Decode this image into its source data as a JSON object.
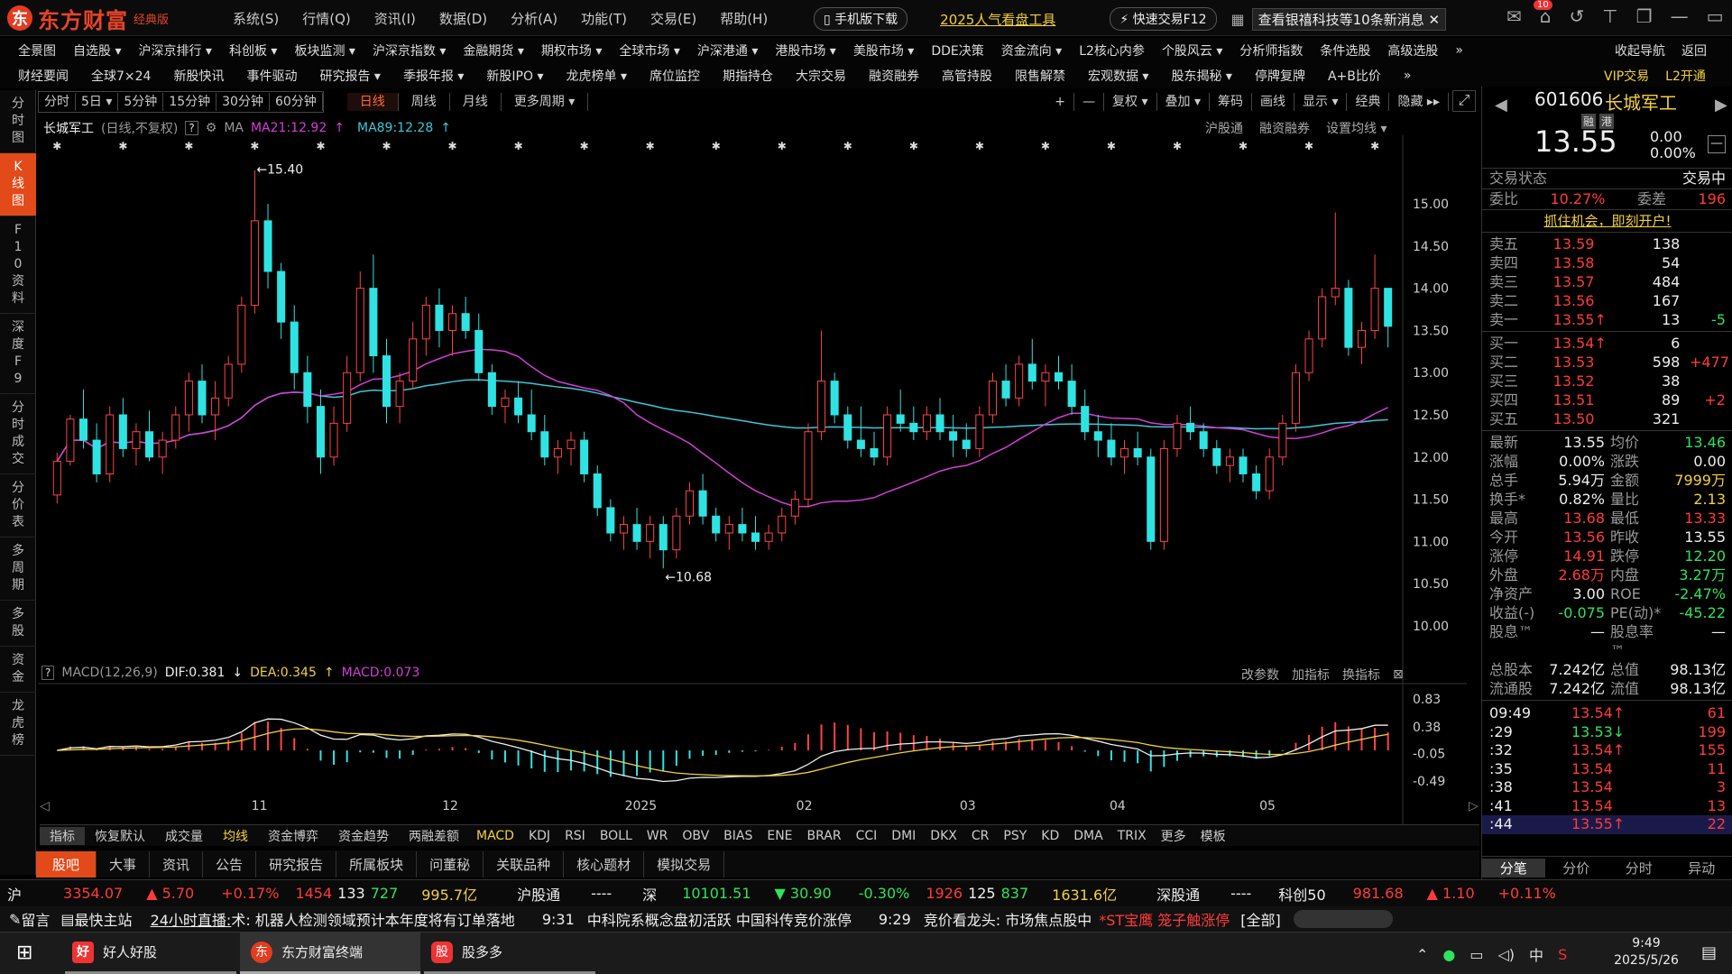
{
  "app": {
    "logo_text": "东方财富",
    "edition": "经典版",
    "logo_mark": "东"
  },
  "menu": [
    "系统(S)",
    "行情(Q)",
    "资讯(I)",
    "数据(D)",
    "分析(A)",
    "功能(T)",
    "交易(E)",
    "帮助(H)"
  ],
  "title_buttons": {
    "mobile": "手机版下载",
    "popular": "2025人气看盘工具",
    "quick_trade": "快速交易F12",
    "news": "查看银禧科技等10条新消息",
    "badge": "10"
  },
  "toolbar1": [
    "全景图",
    "自选股 ▾",
    "沪深京排行 ▾",
    "科创板 ▾",
    "板块监测 ▾",
    "沪深京指数 ▾",
    "金融期货 ▾",
    "期权市场 ▾",
    "全球市场 ▾",
    "沪深港通 ▾",
    "港股市场 ▾",
    "美股市场 ▾",
    "DDE决策",
    "资金流向 ▾",
    "L2核心内参",
    "个股风云 ▾",
    "分析师指数",
    "条件选股",
    "高级选股",
    "»"
  ],
  "toolbar1_right": [
    "收起导航",
    "返回"
  ],
  "toolbar2": [
    "财经要闻",
    "全球7×24",
    "新股快讯",
    "事件驱动",
    "研究报告 ▾",
    "季报年报 ▾",
    "新股IPO ▾",
    "龙虎榜单 ▾",
    "席位监控",
    "期指持仓",
    "大宗交易",
    "融资融券",
    "高管持股",
    "限售解禁",
    "宏观数据 ▾",
    "股东揭秘 ▾",
    "停牌复牌",
    "A+B比价",
    "»"
  ],
  "toolbar2_right": [
    "VIP交易",
    "L2开通"
  ],
  "leftbar": [
    "分时图",
    "K线图",
    "F10资料",
    "深度F9",
    "分时成交",
    "分价表",
    "多周期",
    "多股",
    "资金",
    "龙虎榜"
  ],
  "periods": [
    "分时",
    "5日 ▾",
    "5分钟",
    "15分钟",
    "30分钟",
    "60分钟"
  ],
  "periods2": [
    "日线",
    "周线",
    "月线",
    "更多周期 ▾"
  ],
  "chart_tools": [
    "+",
    "—",
    "复权 ▾",
    "叠加 ▾",
    "筹码",
    "画线",
    "显示 ▾",
    "经典",
    "隐藏 ▸▸"
  ],
  "chart_info": {
    "name": "长城军工",
    "mode": "(日线,不复权)",
    "help": "?",
    "ma_label": "MA",
    "ma21": "MA21:12.92",
    "ma89": "MA89:12.28"
  },
  "chart_links": [
    "沪股通",
    "融资融券",
    "设置均线 ▾"
  ],
  "macd_header": {
    "label": "MACD(12,26,9)",
    "dif": "DIF:0.381",
    "dea": "DEA:0.345",
    "macd": "MACD:0.073"
  },
  "macd_links": [
    "改参数",
    "加指标",
    "换指标"
  ],
  "annotations": {
    "high": "←15.40",
    "low": "←10.68"
  },
  "price_axis": [
    "15.00",
    "14.50",
    "14.00",
    "13.50",
    "13.00",
    "12.50",
    "12.00",
    "11.50",
    "11.00",
    "10.50",
    "10.00"
  ],
  "macd_axis": [
    "0.83",
    "0.38",
    "-0.05",
    "-0.49"
  ],
  "time_axis": [
    "11",
    "12",
    "2025",
    "02",
    "03",
    "04",
    "05"
  ],
  "indicators": [
    "指标",
    "恢复默认",
    "成交量",
    "均线",
    "资金博弈",
    "资金趋势",
    "两融差额",
    "MACD",
    "KDJ",
    "RSI",
    "BOLL",
    "WR",
    "OBV",
    "BIAS",
    "ENE",
    "BRAR",
    "CCI",
    "DMI",
    "DKX",
    "CR",
    "PSY",
    "KD",
    "DMA",
    "TRIX",
    "更多",
    "模板"
  ],
  "bottom_tabs": [
    "股吧",
    "大事",
    "资讯",
    "公告",
    "研究报告",
    "所属板块",
    "问董秘",
    "关联品种",
    "核心题材",
    "模拟交易"
  ],
  "quote": {
    "code": "601606",
    "name": "长城军工",
    "tags": [
      "融",
      "港"
    ],
    "price": "13.55",
    "change": "0.00",
    "pct": "0.00%",
    "status_label": "交易状态",
    "status": "交易中",
    "weibi_label": "委比",
    "weibi": "10.27%",
    "weicha_label": "委差",
    "weicha": "196",
    "promo": "抓住机会，即刻开户!",
    "sells": [
      {
        "l": "卖五",
        "p": "13.59",
        "v": "138",
        "c": ""
      },
      {
        "l": "卖四",
        "p": "13.58",
        "v": "54",
        "c": ""
      },
      {
        "l": "卖三",
        "p": "13.57",
        "v": "484",
        "c": ""
      },
      {
        "l": "卖二",
        "p": "13.56",
        "v": "167",
        "c": ""
      },
      {
        "l": "卖一",
        "p": "13.55↑",
        "v": "13",
        "c": "-5"
      }
    ],
    "buys": [
      {
        "l": "买一",
        "p": "13.54↑",
        "v": "6",
        "c": ""
      },
      {
        "l": "买二",
        "p": "13.53",
        "v": "598",
        "c": "+477"
      },
      {
        "l": "买三",
        "p": "13.52",
        "v": "38",
        "c": ""
      },
      {
        "l": "买四",
        "p": "13.51",
        "v": "89",
        "c": "+2"
      },
      {
        "l": "买五",
        "p": "13.50",
        "v": "321",
        "c": ""
      }
    ],
    "stats": [
      [
        "最新",
        "13.55",
        "均价",
        "13.46"
      ],
      [
        "涨幅",
        "0.00%",
        "涨跌",
        "0.00"
      ],
      [
        "总手",
        "5.94万",
        "金额",
        "7999万"
      ],
      [
        "换手*",
        "0.82%",
        "量比",
        "2.13"
      ],
      [
        "最高",
        "13.68",
        "最低",
        "13.33"
      ],
      [
        "今开",
        "13.56",
        "昨收",
        "13.55"
      ],
      [
        "涨停",
        "14.91",
        "跌停",
        "12.20"
      ],
      [
        "外盘",
        "2.68万",
        "内盘",
        "3.27万"
      ],
      [
        "净资产",
        "3.00",
        "ROE",
        "-2.47%"
      ],
      [
        "收益(-)",
        "-0.075",
        "PE(动)*",
        "-45.22"
      ],
      [
        "股息™",
        "—",
        "股息率™",
        "—"
      ],
      [
        "总股本",
        "7.242亿",
        "总值",
        "98.13亿"
      ],
      [
        "流通股",
        "7.242亿",
        "流值",
        "98.13亿"
      ]
    ],
    "ticks": [
      [
        "09:49",
        "13.54↑",
        "61"
      ],
      [
        ":29",
        "13.53↓",
        "199"
      ],
      [
        ":32",
        "13.54↑",
        "155"
      ],
      [
        ":35",
        "13.54",
        "11"
      ],
      [
        ":38",
        "13.54",
        "3"
      ],
      [
        ":41",
        "13.54",
        "13"
      ],
      [
        ":44",
        "13.55↑",
        "22"
      ]
    ],
    "tabs": [
      "分笔",
      "分价",
      "分时",
      "异动"
    ]
  },
  "indexbar": {
    "sh_label": "沪",
    "sh": "3354.07",
    "sh_chg": "▲ 5.70",
    "sh_pct": "+0.17%",
    "sh_a": "1454",
    "sh_b": "133",
    "sh_c": "727",
    "sh_amt": "995.7亿",
    "hgt": "沪股通",
    "hgt_v": "----",
    "sz_label": "深",
    "sz": "10101.51",
    "sz_chg": "▼ 30.90",
    "sz_pct": "-0.30%",
    "sz_a": "1926",
    "sz_b": "125",
    "sz_c": "837",
    "sz_amt": "1631.6亿",
    "sgt": "深股通",
    "sgt_v": "----",
    "kc": "科创50",
    "kc_v": "981.68",
    "kc_chg": "▲ 1.10",
    "kc_pct": "+0.11%"
  },
  "news": {
    "leave": "留言",
    "fast": "最快主站",
    "live": "24小时直播:",
    "t1": "术: 机器人检测领域预计本年度将有订单落地",
    "time2": "9:31",
    "t2": "中科院系概念盘初活跃 中国科传竞价涨停",
    "time3": "9:29",
    "t3": "竞价看龙头: 市场焦点股中",
    "st": "*ST宝鹰 笼子触涨停",
    "all": "[全部]"
  },
  "taskbar": {
    "apps": [
      "好人好股",
      "东方财富终端",
      "股多多"
    ],
    "time": "9:49",
    "date": "2025/5/26",
    "ime": "中"
  },
  "chart_data": {
    "type": "candlestick",
    "title": "长城军工",
    "period": "日线",
    "ylim": [
      9.4,
      15.6
    ],
    "high_mark": 15.4,
    "low_mark": 10.68,
    "ma": [
      {
        "name": "MA21",
        "color": "#d43fd4",
        "value": 12.92
      },
      {
        "name": "MA89",
        "color": "#3fc6d8",
        "value": 12.28
      }
    ],
    "x_ticks": [
      "11",
      "12",
      "2025",
      "02",
      "03",
      "04",
      "05"
    ],
    "candles_ohlc": [
      [
        11.55,
        12.05,
        11.45,
        11.95
      ],
      [
        11.95,
        12.5,
        11.9,
        12.45
      ],
      [
        12.45,
        12.8,
        12.1,
        12.2
      ],
      [
        12.2,
        12.4,
        11.7,
        11.8
      ],
      [
        11.8,
        12.6,
        11.7,
        12.5
      ],
      [
        12.5,
        12.7,
        12.0,
        12.1
      ],
      [
        12.1,
        12.4,
        11.9,
        12.3
      ],
      [
        12.3,
        12.55,
        11.95,
        12.0
      ],
      [
        12.0,
        12.3,
        11.8,
        12.2
      ],
      [
        12.2,
        12.6,
        12.1,
        12.5
      ],
      [
        12.5,
        13.0,
        12.3,
        12.9
      ],
      [
        12.9,
        13.1,
        12.4,
        12.5
      ],
      [
        12.5,
        12.9,
        12.2,
        12.7
      ],
      [
        12.7,
        13.2,
        12.6,
        13.1
      ],
      [
        13.1,
        13.9,
        13.0,
        13.8
      ],
      [
        13.8,
        15.4,
        13.7,
        14.8
      ],
      [
        14.8,
        15.0,
        14.0,
        14.2
      ],
      [
        14.2,
        14.3,
        13.4,
        13.6
      ],
      [
        13.6,
        13.8,
        12.8,
        13.0
      ],
      [
        13.0,
        13.2,
        12.4,
        12.6
      ],
      [
        12.6,
        12.8,
        11.8,
        12.0
      ],
      [
        12.0,
        12.6,
        11.9,
        12.4
      ],
      [
        12.4,
        13.2,
        12.3,
        13.0
      ],
      [
        13.0,
        14.2,
        12.9,
        14.0
      ],
      [
        14.0,
        14.4,
        13.0,
        13.2
      ],
      [
        13.2,
        13.4,
        12.4,
        12.6
      ],
      [
        12.6,
        13.0,
        12.4,
        12.9
      ],
      [
        12.9,
        13.6,
        12.8,
        13.4
      ],
      [
        13.4,
        13.9,
        13.2,
        13.8
      ],
      [
        13.8,
        14.0,
        13.3,
        13.5
      ],
      [
        13.5,
        13.8,
        13.2,
        13.7
      ],
      [
        13.7,
        13.9,
        13.4,
        13.5
      ],
      [
        13.5,
        13.7,
        12.9,
        13.0
      ],
      [
        13.0,
        13.1,
        12.5,
        12.6
      ],
      [
        12.6,
        12.8,
        12.4,
        12.7
      ],
      [
        12.7,
        12.9,
        12.4,
        12.5
      ],
      [
        12.5,
        12.8,
        12.2,
        12.3
      ],
      [
        12.3,
        12.5,
        11.9,
        12.0
      ],
      [
        12.0,
        12.2,
        11.8,
        12.1
      ],
      [
        12.1,
        12.3,
        11.9,
        12.2
      ],
      [
        12.2,
        12.3,
        11.7,
        11.8
      ],
      [
        11.8,
        11.9,
        11.3,
        11.4
      ],
      [
        11.4,
        11.5,
        11.0,
        11.1
      ],
      [
        11.1,
        11.3,
        10.9,
        11.2
      ],
      [
        11.2,
        11.4,
        10.9,
        11.0
      ],
      [
        11.0,
        11.3,
        10.8,
        11.2
      ],
      [
        11.2,
        11.3,
        10.68,
        10.9
      ],
      [
        10.9,
        11.4,
        10.8,
        11.3
      ],
      [
        11.3,
        11.7,
        11.2,
        11.6
      ],
      [
        11.6,
        11.8,
        11.2,
        11.3
      ],
      [
        11.3,
        11.4,
        11.0,
        11.1
      ],
      [
        11.1,
        11.3,
        10.9,
        11.2
      ],
      [
        11.2,
        11.4,
        11.0,
        11.1
      ],
      [
        11.1,
        11.3,
        10.9,
        11.0
      ],
      [
        11.0,
        11.2,
        10.9,
        11.1
      ],
      [
        11.1,
        11.4,
        11.0,
        11.3
      ],
      [
        11.3,
        11.6,
        11.2,
        11.5
      ],
      [
        11.5,
        12.4,
        11.4,
        12.3
      ],
      [
        12.3,
        13.5,
        12.2,
        12.9
      ],
      [
        12.9,
        13.0,
        12.4,
        12.5
      ],
      [
        12.5,
        12.6,
        12.1,
        12.2
      ],
      [
        12.2,
        12.6,
        12.0,
        12.1
      ],
      [
        12.1,
        12.3,
        11.9,
        12.0
      ],
      [
        12.0,
        12.6,
        11.9,
        12.5
      ],
      [
        12.5,
        12.8,
        12.3,
        12.4
      ],
      [
        12.4,
        12.6,
        12.2,
        12.3
      ],
      [
        12.3,
        12.6,
        12.2,
        12.5
      ],
      [
        12.5,
        12.7,
        12.2,
        12.3
      ],
      [
        12.3,
        12.5,
        12.0,
        12.2
      ],
      [
        12.2,
        12.4,
        12.0,
        12.1
      ],
      [
        12.1,
        12.6,
        12.0,
        12.5
      ],
      [
        12.5,
        13.0,
        12.4,
        12.9
      ],
      [
        12.9,
        13.1,
        12.6,
        12.7
      ],
      [
        12.7,
        13.2,
        12.6,
        13.1
      ],
      [
        13.1,
        13.4,
        12.8,
        12.9
      ],
      [
        12.9,
        13.1,
        12.6,
        13.0
      ],
      [
        13.0,
        13.2,
        12.8,
        12.9
      ],
      [
        12.9,
        13.1,
        12.5,
        12.6
      ],
      [
        12.6,
        12.8,
        12.2,
        12.3
      ],
      [
        12.3,
        12.5,
        12.0,
        12.2
      ],
      [
        12.2,
        12.4,
        11.9,
        12.0
      ],
      [
        12.0,
        12.2,
        11.8,
        12.1
      ],
      [
        12.1,
        12.3,
        11.9,
        12.0
      ],
      [
        12.0,
        12.1,
        10.9,
        11.0
      ],
      [
        11.0,
        12.2,
        10.9,
        12.1
      ],
      [
        12.1,
        12.5,
        12.0,
        12.4
      ],
      [
        12.4,
        12.6,
        12.2,
        12.3
      ],
      [
        12.3,
        12.4,
        12.0,
        12.1
      ],
      [
        12.1,
        12.2,
        11.8,
        11.9
      ],
      [
        11.9,
        12.1,
        11.7,
        12.0
      ],
      [
        12.0,
        12.1,
        11.7,
        11.8
      ],
      [
        11.8,
        11.9,
        11.5,
        11.6
      ],
      [
        11.6,
        12.1,
        11.5,
        12.0
      ],
      [
        12.0,
        12.5,
        11.9,
        12.4
      ],
      [
        12.4,
        13.1,
        12.3,
        13.0
      ],
      [
        13.0,
        13.5,
        12.9,
        13.4
      ],
      [
        13.4,
        14.0,
        13.3,
        13.9
      ],
      [
        13.9,
        14.9,
        13.8,
        14.0
      ],
      [
        14.0,
        14.1,
        13.2,
        13.3
      ],
      [
        13.3,
        13.6,
        13.1,
        13.5
      ],
      [
        13.5,
        14.4,
        13.4,
        14.0
      ],
      [
        14.0,
        14.0,
        13.3,
        13.55
      ]
    ],
    "macd_ylim": [
      -0.55,
      0.9
    ]
  }
}
